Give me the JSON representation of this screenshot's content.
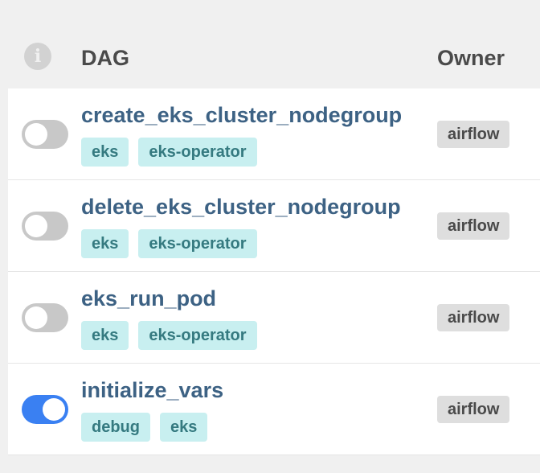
{
  "header": {
    "info_icon": "info-icon",
    "dag_label": "DAG",
    "owner_label": "Owner"
  },
  "rows": [
    {
      "dag": "create_eks_cluster_nodegroup",
      "tags": [
        "eks",
        "eks-operator"
      ],
      "owner": "airflow",
      "enabled": false
    },
    {
      "dag": "delete_eks_cluster_nodegroup",
      "tags": [
        "eks",
        "eks-operator"
      ],
      "owner": "airflow",
      "enabled": false
    },
    {
      "dag": "eks_run_pod",
      "tags": [
        "eks",
        "eks-operator"
      ],
      "owner": "airflow",
      "enabled": false
    },
    {
      "dag": "initialize_vars",
      "tags": [
        "debug",
        "eks"
      ],
      "owner": "airflow",
      "enabled": true
    }
  ],
  "colors": {
    "toggle_on": "#3a80f2",
    "toggle_off": "#c8c8c8",
    "dag_link": "#3d6284",
    "tag_bg": "#c8eff0",
    "tag_text": "#357a80"
  }
}
